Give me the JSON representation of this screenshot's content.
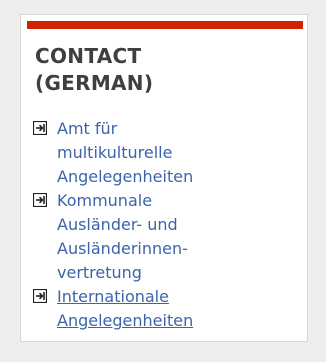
{
  "panel": {
    "heading_line1": "CONTACT",
    "heading_line2": "(GERMAN)",
    "accent_color": "#d32200",
    "link_color": "#3d63ac",
    "links": [
      {
        "lines": [
          "Amt für",
          "multikulturelle",
          "Angelegenheiten"
        ],
        "icon": "arrow-into-box-icon",
        "underlined": false
      },
      {
        "lines": [
          "Kommunale",
          "Ausländer- und",
          "Ausländerinnen-",
          "vertretung"
        ],
        "icon": "arrow-into-box-icon",
        "underlined": false
      },
      {
        "lines": [
          "Internationale",
          "Angelegenheiten"
        ],
        "icon": "arrow-into-box-icon",
        "underlined": true
      }
    ]
  }
}
